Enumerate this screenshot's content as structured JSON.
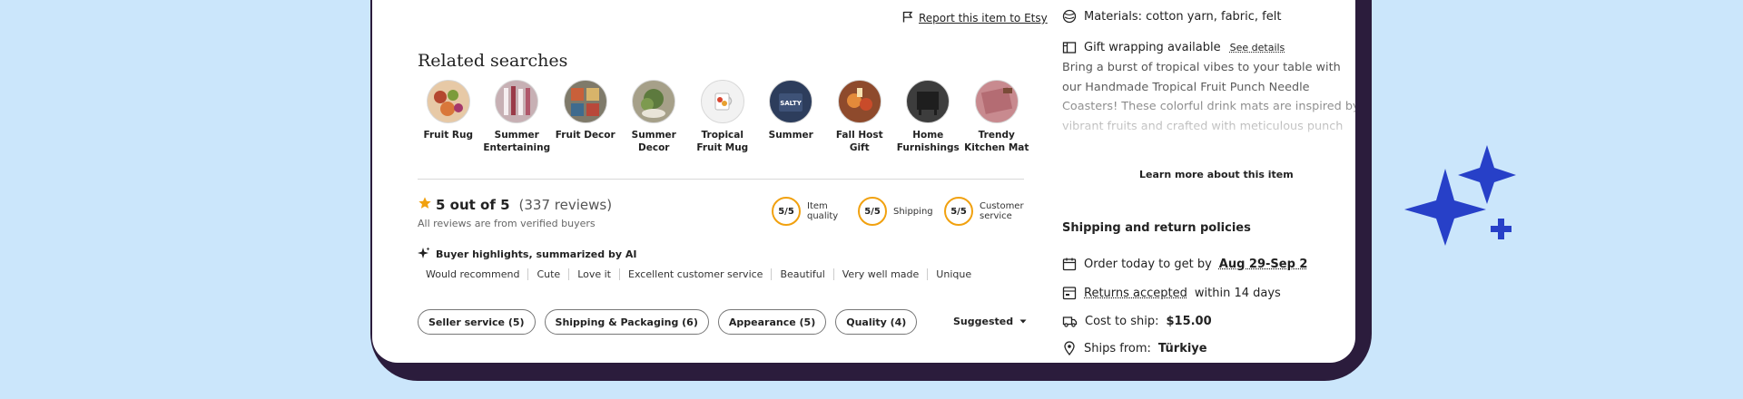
{
  "report": {
    "label": "Report this item to Etsy",
    "icon": "flag-icon"
  },
  "related_searches": {
    "title": "Related searches",
    "items": [
      {
        "label": "Fruit Rug",
        "color": "#e7c9a6"
      },
      {
        "label": "Summer Entertaining",
        "color": "#c7b0b4"
      },
      {
        "label": "Fruit Decor",
        "color": "#7f7a6a"
      },
      {
        "label": "Summer Decor",
        "color": "#a6a089"
      },
      {
        "label": "Tropical Fruit Mug",
        "color": "#f2f2f2"
      },
      {
        "label": "Summer",
        "color": "#2d3d5c",
        "thumb_text": "SALTY"
      },
      {
        "label": "Fall Host Gift",
        "color": "#8e4a2c"
      },
      {
        "label": "Home Furnishings",
        "color": "#3d3d3d"
      },
      {
        "label": "Trendy Kitchen Mat",
        "color": "#c88a8f"
      }
    ]
  },
  "reviews": {
    "rating_text": "5 out of 5",
    "review_count": "(337 reviews)",
    "verified_text": "All reviews are from verified buyers",
    "scores": [
      {
        "value": "5/5",
        "label": "Item quality"
      },
      {
        "value": "5/5",
        "label": "Shipping"
      },
      {
        "value": "5/5",
        "label": "Customer service"
      }
    ],
    "highlights_title": "Buyer highlights, summarized by AI",
    "tags": [
      "Would recommend",
      "Cute",
      "Love it",
      "Excellent customer service",
      "Beautiful",
      "Very well made",
      "Unique"
    ],
    "filters": [
      "Seller service (5)",
      "Shipping & Packaging (6)",
      "Appearance (5)",
      "Quality (4)"
    ],
    "sort_label": "Suggested"
  },
  "details": {
    "materials": "Materials: cotton yarn, fabric, felt",
    "gift_wrapping": "Gift wrapping available",
    "see_details": "See details",
    "description": "Bring a burst of tropical vibes to your table with our Handmade Tropical Fruit Punch Needle Coasters! These colorful drink mats are inspired by vibrant fruits and crafted with meticulous punch needle art. Perfect",
    "learn_more": "Learn more about this item"
  },
  "shipping": {
    "title": "Shipping and return policies",
    "order_prefix": "Order today to get by",
    "order_date": "Aug 29-Sep 2",
    "returns_link": "Returns accepted",
    "returns_suffix": "within 14 days",
    "cost_prefix": "Cost to ship:",
    "cost_value": "$15.00",
    "from_prefix": "Ships from:",
    "from_value": "Türkiye"
  },
  "colors": {
    "background": "#cbe6fb",
    "device_frame": "#2b1c3c",
    "star": "#f1a10f",
    "sparkle": "#2740c8"
  }
}
